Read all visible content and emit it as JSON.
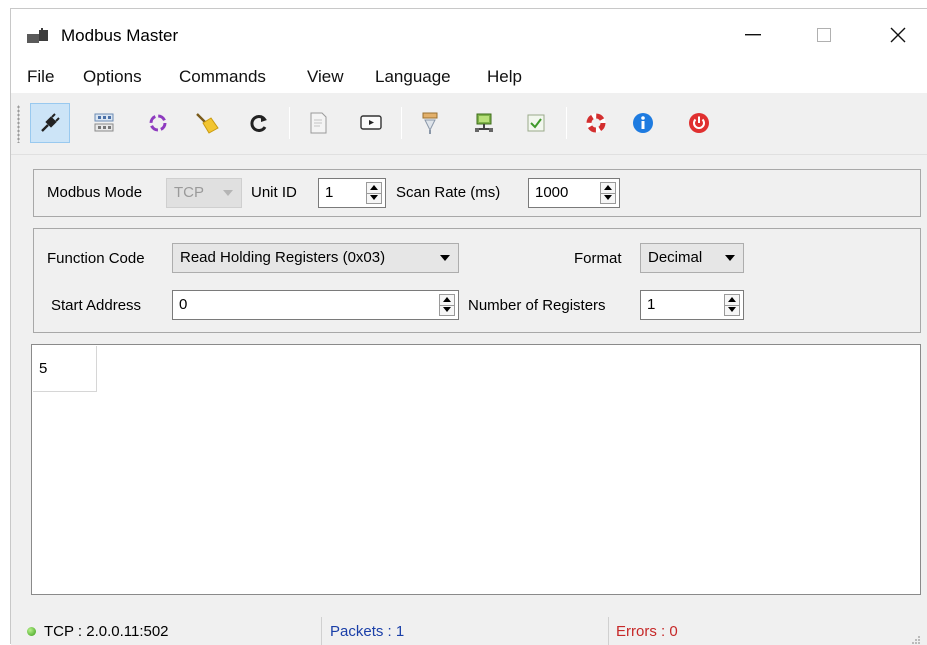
{
  "window": {
    "title": "Modbus Master",
    "controls": {
      "minimize": "—",
      "maximize": "☐",
      "close": "✕"
    }
  },
  "menu": [
    "File",
    "Options",
    "Commands",
    "View",
    "Language",
    "Help"
  ],
  "toolbar": {
    "buttons": [
      {
        "icon": "connect-plug-icon",
        "active": true
      },
      {
        "icon": "settings-grid-icon"
      },
      {
        "icon": "scan-cycle-icon"
      },
      {
        "icon": "clear-broom-icon"
      },
      {
        "icon": "refresh-icon"
      },
      {
        "icon": "log-document-icon"
      },
      {
        "icon": "monitor-icon"
      },
      {
        "icon": "bus-monitor-icon"
      },
      {
        "icon": "network-icon"
      },
      {
        "icon": "checkbox-icon"
      },
      {
        "icon": "help-lifebuoy-icon"
      },
      {
        "icon": "info-icon"
      },
      {
        "icon": "exit-power-icon"
      }
    ]
  },
  "connection": {
    "mode_label": "Modbus Mode",
    "mode_value": "TCP",
    "unit_id_label": "Unit ID",
    "unit_id_value": "1",
    "scan_rate_label": "Scan Rate (ms)",
    "scan_rate_value": "1000"
  },
  "request": {
    "function_code_label": "Function Code",
    "function_code_value": "Read Holding Registers (0x03)",
    "format_label": "Format",
    "format_value": "Decimal",
    "start_address_label": "Start Address",
    "start_address_value": "0",
    "num_registers_label": "Number of Registers",
    "num_registers_value": "1"
  },
  "data_view": {
    "values": [
      "5"
    ]
  },
  "status": {
    "connection": "TCP : 2.0.0.11:502",
    "packets": "Packets : 1",
    "errors": "Errors : 0",
    "colors": {
      "packets": "#1a3fa8",
      "errors": "#c62828",
      "connected": "#3a9d1a"
    }
  }
}
